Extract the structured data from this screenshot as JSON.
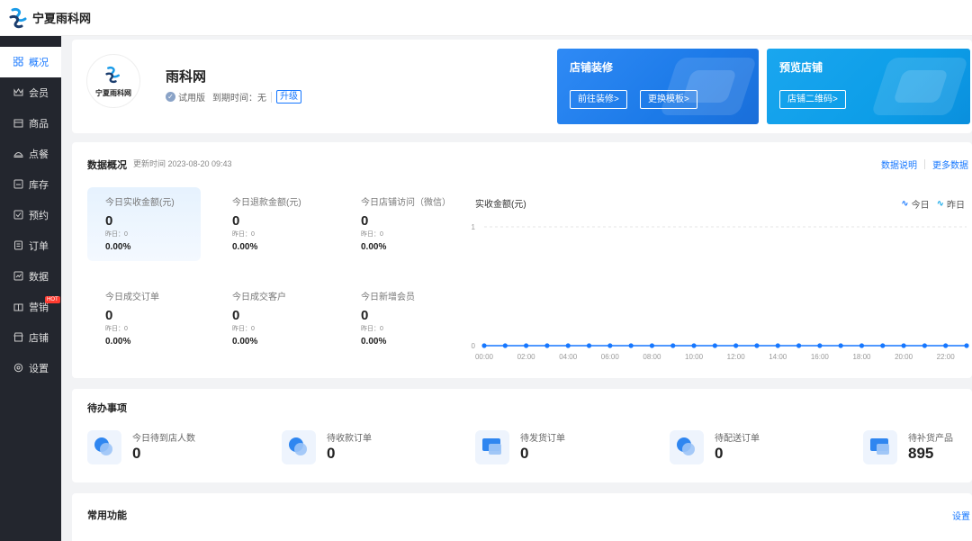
{
  "brand": {
    "logo_text": "宁夏雨科网"
  },
  "sidebar": {
    "items": [
      {
        "label": "概况",
        "icon": "grid-icon",
        "active": true
      },
      {
        "label": "会员",
        "icon": "crown-icon"
      },
      {
        "label": "商品",
        "icon": "shop-icon"
      },
      {
        "label": "点餐",
        "icon": "dish-icon"
      },
      {
        "label": "库存",
        "icon": "box-icon"
      },
      {
        "label": "预约",
        "icon": "calendar-check-icon"
      },
      {
        "label": "订单",
        "icon": "order-icon"
      },
      {
        "label": "数据",
        "icon": "chart-icon"
      },
      {
        "label": "营销",
        "icon": "gift-icon",
        "badge": "HOT"
      },
      {
        "label": "店铺",
        "icon": "store-icon"
      },
      {
        "label": "设置",
        "icon": "gear-icon"
      }
    ]
  },
  "store": {
    "logo_caption": "宁夏雨科网",
    "name": "雨科网",
    "edition": "试用版",
    "expiry": "到期时间：无",
    "upgrade": "升级"
  },
  "promos": {
    "decorate": {
      "title": "店铺装修",
      "btn1": "前往装修>",
      "btn2": "更换模板>"
    },
    "preview": {
      "title": "预览店铺",
      "btn1": "店铺二维码>"
    }
  },
  "overview": {
    "title": "数据概况",
    "update_time": "更新时间 2023-08-20 09:43",
    "link_explain": "数据说明",
    "link_more": "更多数据",
    "stats": [
      {
        "label": "今日实收金额(元)",
        "value": "0",
        "yesterday": "昨日：0",
        "pct": "0.00%"
      },
      {
        "label": "今日退款金额(元)",
        "value": "0",
        "yesterday": "昨日：0",
        "pct": "0.00%"
      },
      {
        "label": "今日店铺访问（微信）",
        "value": "0",
        "yesterday": "昨日：0",
        "pct": "0.00%"
      },
      {
        "label": "今日成交订单",
        "value": "0",
        "yesterday": "昨日：0",
        "pct": "0.00%"
      },
      {
        "label": "今日成交客户",
        "value": "0",
        "yesterday": "昨日：0",
        "pct": "0.00%"
      },
      {
        "label": "今日新增会员",
        "value": "0",
        "yesterday": "昨日：0",
        "pct": "0.00%"
      }
    ],
    "chart_title": "实收金额(元)",
    "legend_today": "今日",
    "legend_yesterday": "昨日"
  },
  "chart_data": {
    "type": "line",
    "title": "实收金额(元)",
    "xlabel": "",
    "ylabel": "",
    "ylim": [
      0,
      1
    ],
    "y_ticks": [
      "0",
      "1"
    ],
    "x": [
      "00:00",
      "01:00",
      "02:00",
      "03:00",
      "04:00",
      "05:00",
      "06:00",
      "07:00",
      "08:00",
      "09:00",
      "10:00",
      "11:00",
      "12:00",
      "13:00",
      "14:00",
      "15:00",
      "16:00",
      "17:00",
      "18:00",
      "19:00",
      "20:00",
      "21:00",
      "22:00",
      "23:00"
    ],
    "x_tick_labels": [
      "00:00",
      "02:00",
      "04:00",
      "06:00",
      "08:00",
      "10:00",
      "12:00",
      "14:00",
      "16:00",
      "18:00",
      "20:00",
      "22:00"
    ],
    "series": [
      {
        "name": "今日",
        "color": "#1677ff",
        "values": [
          0,
          0,
          0,
          0,
          0,
          0,
          0,
          0,
          0,
          0,
          0,
          0,
          0,
          0,
          0,
          0,
          0,
          0,
          0,
          0,
          0,
          0,
          0,
          0
        ]
      }
    ],
    "legend": [
      "今日",
      "昨日"
    ],
    "legend_position": "top-right",
    "grid": true
  },
  "todo": {
    "title": "待办事项",
    "items": [
      {
        "label": "今日待到店人数",
        "value": "0",
        "icon": "person-visit-icon"
      },
      {
        "label": "待收款订单",
        "value": "0",
        "icon": "payment-icon"
      },
      {
        "label": "待发货订单",
        "value": "0",
        "icon": "shipping-icon"
      },
      {
        "label": "待配送订单",
        "value": "0",
        "icon": "delivery-icon"
      },
      {
        "label": "待补货产品",
        "value": "895",
        "icon": "restock-icon"
      }
    ]
  },
  "common": {
    "title": "常用功能",
    "settings": "设置"
  },
  "colors": {
    "accent": "#1677ff",
    "sidebar_bg": "#23262e",
    "promo1": "#1c7ae8",
    "promo2": "#0d9ee8"
  }
}
